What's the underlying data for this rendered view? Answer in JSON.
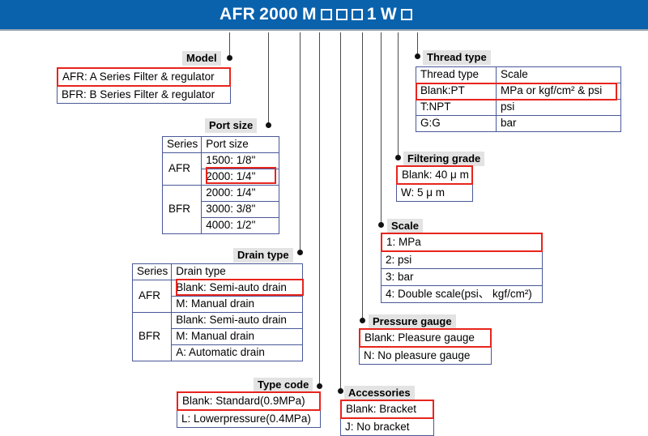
{
  "header": {
    "code_segments": [
      "AFR",
      "2000",
      "M"
    ],
    "code_full": "AFR 2000 M □ □ □ 1 W □",
    "trailing_segments": [
      "1",
      "W"
    ],
    "box_glyph": "□",
    "boxes_before_count": 3,
    "boxes_after_count": 1
  },
  "colors": {
    "banner_blue": "#0a62ad",
    "selection_red": "#e8241c",
    "table_border_blue": "#4a5899",
    "caption_background": "#e3e3e3",
    "connector_gray": "#4b4b4b"
  },
  "sections": {
    "model": {
      "caption": "Model",
      "options": [
        {
          "text": "AFR: A Series Filter & regulator",
          "selected": true
        },
        {
          "text": "BFR: B Series Filter & regulator",
          "selected": false
        }
      ]
    },
    "port_size": {
      "caption": "Port size",
      "columns": [
        "Series",
        "Port size"
      ],
      "groups": [
        {
          "series": "AFR",
          "rows": [
            {
              "text": "1500: 1/8\"",
              "selected": false
            },
            {
              "text": "2000: 1/4\"",
              "selected": true
            }
          ]
        },
        {
          "series": "BFR",
          "rows": [
            {
              "text": "2000: 1/4\"",
              "selected": false
            },
            {
              "text": "3000: 3/8\"",
              "selected": false
            },
            {
              "text": "4000: 1/2\"",
              "selected": false
            }
          ]
        }
      ]
    },
    "drain_type": {
      "caption": "Drain type",
      "columns": [
        "Series",
        "Drain type"
      ],
      "groups": [
        {
          "series": "AFR",
          "rows": [
            {
              "text": "Blank: Semi-auto drain",
              "selected": true
            },
            {
              "text": "M: Manual drain",
              "selected": false
            }
          ]
        },
        {
          "series": "BFR",
          "rows": [
            {
              "text": "Blank: Semi-auto drain",
              "selected": false
            },
            {
              "text": "M: Manual drain",
              "selected": false
            },
            {
              "text": "A: Automatic drain",
              "selected": false
            }
          ]
        }
      ]
    },
    "type_code": {
      "caption": "Type code",
      "options": [
        {
          "text": "Blank: Standard(0.9MPa)",
          "selected": true
        },
        {
          "text": "L: Lowerpressure(0.4MPa)",
          "selected": false
        }
      ]
    },
    "accessories": {
      "caption": "Accessories",
      "options": [
        {
          "text": "Blank: Bracket",
          "selected": true
        },
        {
          "text": "J: No bracket",
          "selected": false
        }
      ]
    },
    "pressure_gauge": {
      "caption": "Pressure gauge",
      "options": [
        {
          "text": "Blank: Pleasure gauge",
          "selected": true
        },
        {
          "text": "N: No pleasure gauge",
          "selected": false
        }
      ]
    },
    "scale": {
      "caption": "Scale",
      "options": [
        {
          "text": "1: MPa",
          "selected": true
        },
        {
          "text": "2: psi",
          "selected": false
        },
        {
          "text": "3: bar",
          "selected": false
        },
        {
          "text": "4: Double scale(psi、 kgf/cm²)",
          "selected": false
        }
      ]
    },
    "filtering_grade": {
      "caption": "Filtering grade",
      "options": [
        {
          "text": "Blank: 40 μ m",
          "selected": true
        },
        {
          "text": "W: 5 μ m",
          "selected": false
        }
      ]
    },
    "thread_type": {
      "caption": "Thread type",
      "columns": [
        "Thread type",
        "Scale"
      ],
      "rows": [
        {
          "code": "Blank:PT",
          "scale": "MPa or  kgf/cm² & psi",
          "selected": true
        },
        {
          "code": "T:NPT",
          "scale": "psi",
          "selected": false
        },
        {
          "code": "G:G",
          "scale": "bar",
          "selected": false
        }
      ]
    }
  }
}
